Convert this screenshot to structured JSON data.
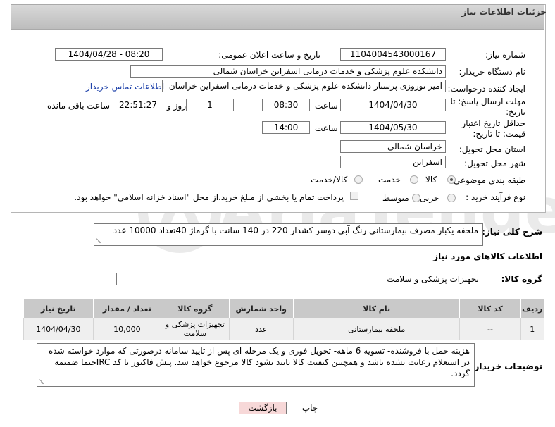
{
  "panel": {
    "title": "جزئیات اطلاعات نیاز"
  },
  "form": {
    "need_number_label": "شماره نیاز:",
    "need_number": "1104004543000167",
    "announce_label": "تاریخ و ساعت اعلان عمومی:",
    "announce_value": "1404/04/28 - 08:20",
    "buyer_org_label": "نام دستگاه خریدار:",
    "buyer_org": "دانشکده علوم پزشکی و خدمات درمانی اسفراین خراسان شمالی",
    "creator_label": "ایجاد کننده درخواست:",
    "creator": "امیر  نوروزی  پرستار  دانشکده علوم پزشکی و خدمات درمانی اسفراین خراسان",
    "contact_link": "اطلاعات تماس خریدار",
    "deadline_label": "مهلت ارسال پاسخ: تا تاریخ:",
    "deadline_date": "1404/04/30",
    "time_word": "ساعت",
    "deadline_time": "08:30",
    "days_value": "1",
    "days_and": "روز و",
    "remaining_time": "22:51:27",
    "remaining_label": "ساعت باقی مانده",
    "validity_label": "حداقل تاریخ اعتبار قیمت: تا تاریخ:",
    "validity_date": "1404/05/30",
    "validity_time": "14:00",
    "province_label": "استان محل تحویل:",
    "province": "خراسان شمالی",
    "city_label": "شهر محل تحویل:",
    "city": "اسفراین",
    "category_label": "طبقه بندی موضوعی:",
    "category_options": [
      "کالا",
      "خدمت",
      "کالا/خدمت"
    ],
    "category_selected": "کالا",
    "process_label": "نوع فرآیند خرید :",
    "process_options": [
      "جزیی",
      "متوسط"
    ],
    "payment_note": "پرداخت تمام یا بخشی از مبلغ خرید،از محل \"اسناد خزانه اسلامی\" خواهد بود."
  },
  "summary": {
    "label": "شرح کلی نیاز:",
    "text": "ملحفه یکبار مصرف بیمارستانی رنگ آبی دوسر کشدار 220 در 140 سانت با گرماژ 40تعداد 10000 عدد"
  },
  "goods_section": {
    "title": "اطلاعات کالاهای مورد نیاز",
    "group_label": "گروه کالا:",
    "group_value": "تجهیزات پزشکی و سلامت"
  },
  "table": {
    "headers": [
      "ردیف",
      "کد کالا",
      "نام کالا",
      "واحد شمارش",
      "گروه کالا",
      "تعداد / مقدار",
      "تاریخ نیاز"
    ],
    "rows": [
      [
        "1",
        "--",
        "ملحفه بیمارستانی",
        "عدد",
        "تجهیزات پزشکی و سلامت",
        "10,000",
        "1404/04/30"
      ]
    ]
  },
  "buyer_notes": {
    "label": "توضیحات خریدار:",
    "text": "هزینه حمل با فروشنده- تسویه 6 ماهه- تحویل فوری و یک مرحله ای پس از تایید سامانه درصورتی که موارد خواسته شده در استعلام رعایت نشده باشد و همچنین کیفیت کالا تایید نشود کالا مرجوع خواهد شد. پیش فاکتور با کد IRCحتما ضمیمه گردد."
  },
  "buttons": {
    "print": "چاپ",
    "back": "بازگشت"
  },
  "watermark": {
    "text": "AriaTender.net"
  },
  "colors": {
    "link": "#1a3ea8",
    "back_button": "#f7d8d8",
    "table_header": "#c9c9c9"
  }
}
